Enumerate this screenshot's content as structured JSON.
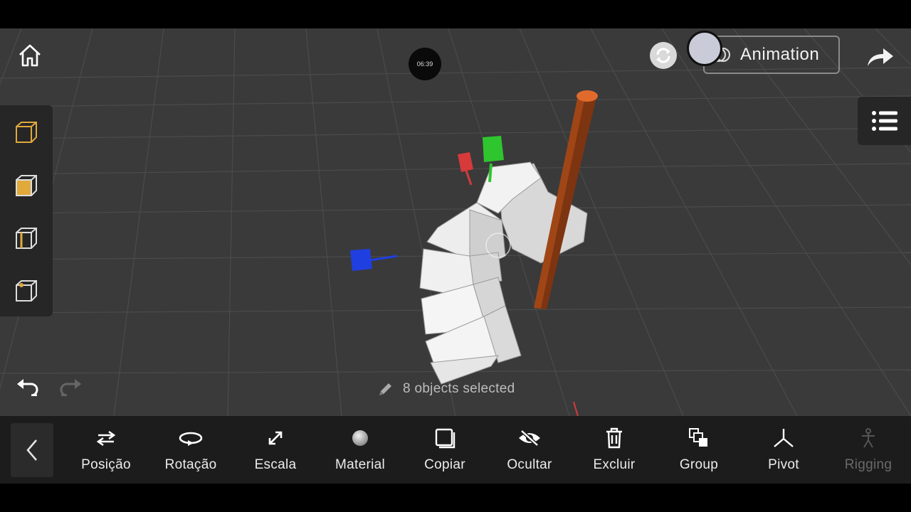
{
  "top_bar": {
    "timer": "06:39",
    "animation_label": "Animation"
  },
  "left_panel": {
    "view_icons": [
      "cube-wireframe-icon",
      "cube-face-left-icon",
      "cube-edge-icon",
      "cube-vertex-icon"
    ],
    "accent_color": "#e0a93a"
  },
  "history": {
    "undo_icon": "undo-icon",
    "redo_icon": "redo-icon"
  },
  "status": {
    "selection_text": "8 objects selected"
  },
  "toolbar": {
    "items": [
      {
        "label": "Posição",
        "icon": "position-arrows-icon"
      },
      {
        "label": "Rotação",
        "icon": "rotation-icon"
      },
      {
        "label": "Escala",
        "icon": "scale-icon"
      },
      {
        "label": "Material",
        "icon": "material-sphere-icon"
      },
      {
        "label": "Copiar",
        "icon": "copy-icon"
      },
      {
        "label": "Ocultar",
        "icon": "hide-eye-icon"
      },
      {
        "label": "Excluir",
        "icon": "trash-icon"
      },
      {
        "label": "Group",
        "icon": "group-icon"
      },
      {
        "label": "Pivot",
        "icon": "pivot-icon"
      },
      {
        "label": "Rigging",
        "icon": "rigging-icon"
      }
    ]
  },
  "colors": {
    "viewport_bg": "#3a3a3b",
    "toolbar_bg": "#1c1c1d",
    "gizmo_x": "#d63a3a",
    "gizmo_y": "#2ec52e",
    "gizmo_z": "#1f3fe0",
    "pole": "#8a3a10"
  }
}
